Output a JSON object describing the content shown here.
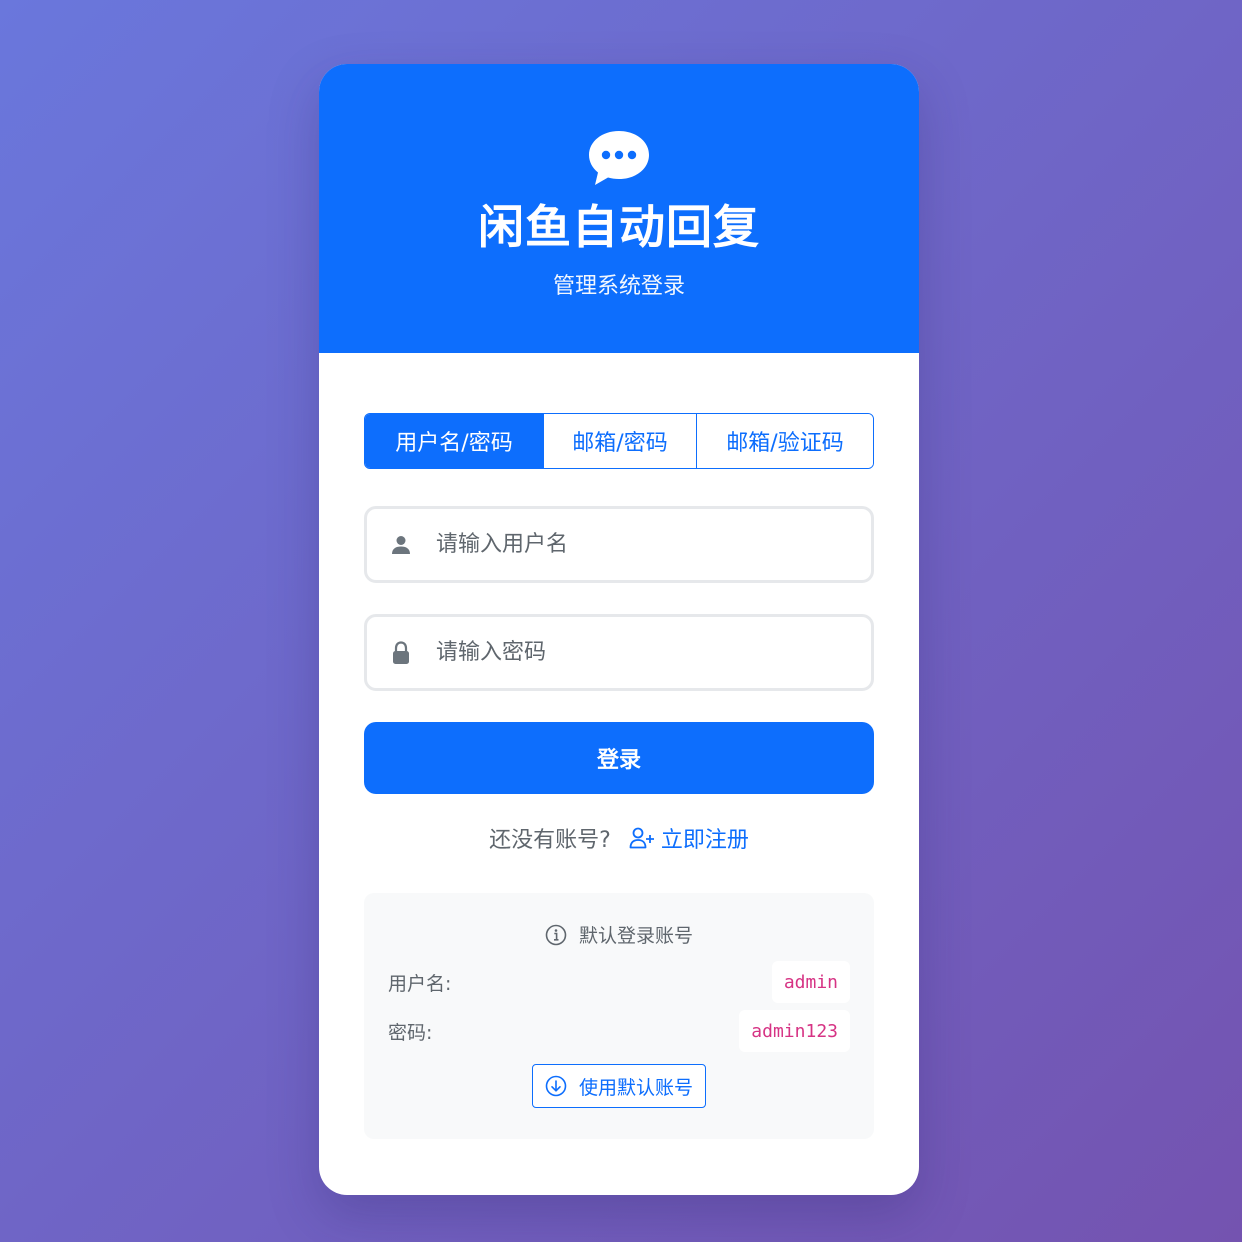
{
  "header": {
    "logo_icon": "chat-bubble-dots-icon",
    "title": "闲鱼自动回复",
    "subtitle": "管理系统登录"
  },
  "tabs": [
    {
      "label": "用户名/密码",
      "active": true
    },
    {
      "label": "邮箱/密码",
      "active": false
    },
    {
      "label": "邮箱/验证码",
      "active": false
    }
  ],
  "form": {
    "username_icon": "person-icon",
    "username_placeholder": "请输入用户名",
    "username_value": "",
    "password_icon": "lock-icon",
    "password_placeholder": "请输入密码",
    "password_value": "",
    "login_label": "登录"
  },
  "register": {
    "prompt": "还没有账号?",
    "link_icon": "person-plus-icon",
    "link_label": "立即注册"
  },
  "default_account": {
    "title_icon": "info-circle-icon",
    "title": "默认登录账号",
    "username_label": "用户名:",
    "username_value": "admin",
    "password_label": "密码:",
    "password_value": "admin123",
    "button_icon": "arrow-down-circle-icon",
    "button_label": "使用默认账号"
  },
  "colors": {
    "primary": "#0d6efd",
    "code": "#d63384",
    "background_start": "#6a77dc",
    "background_end": "#7453b0"
  }
}
